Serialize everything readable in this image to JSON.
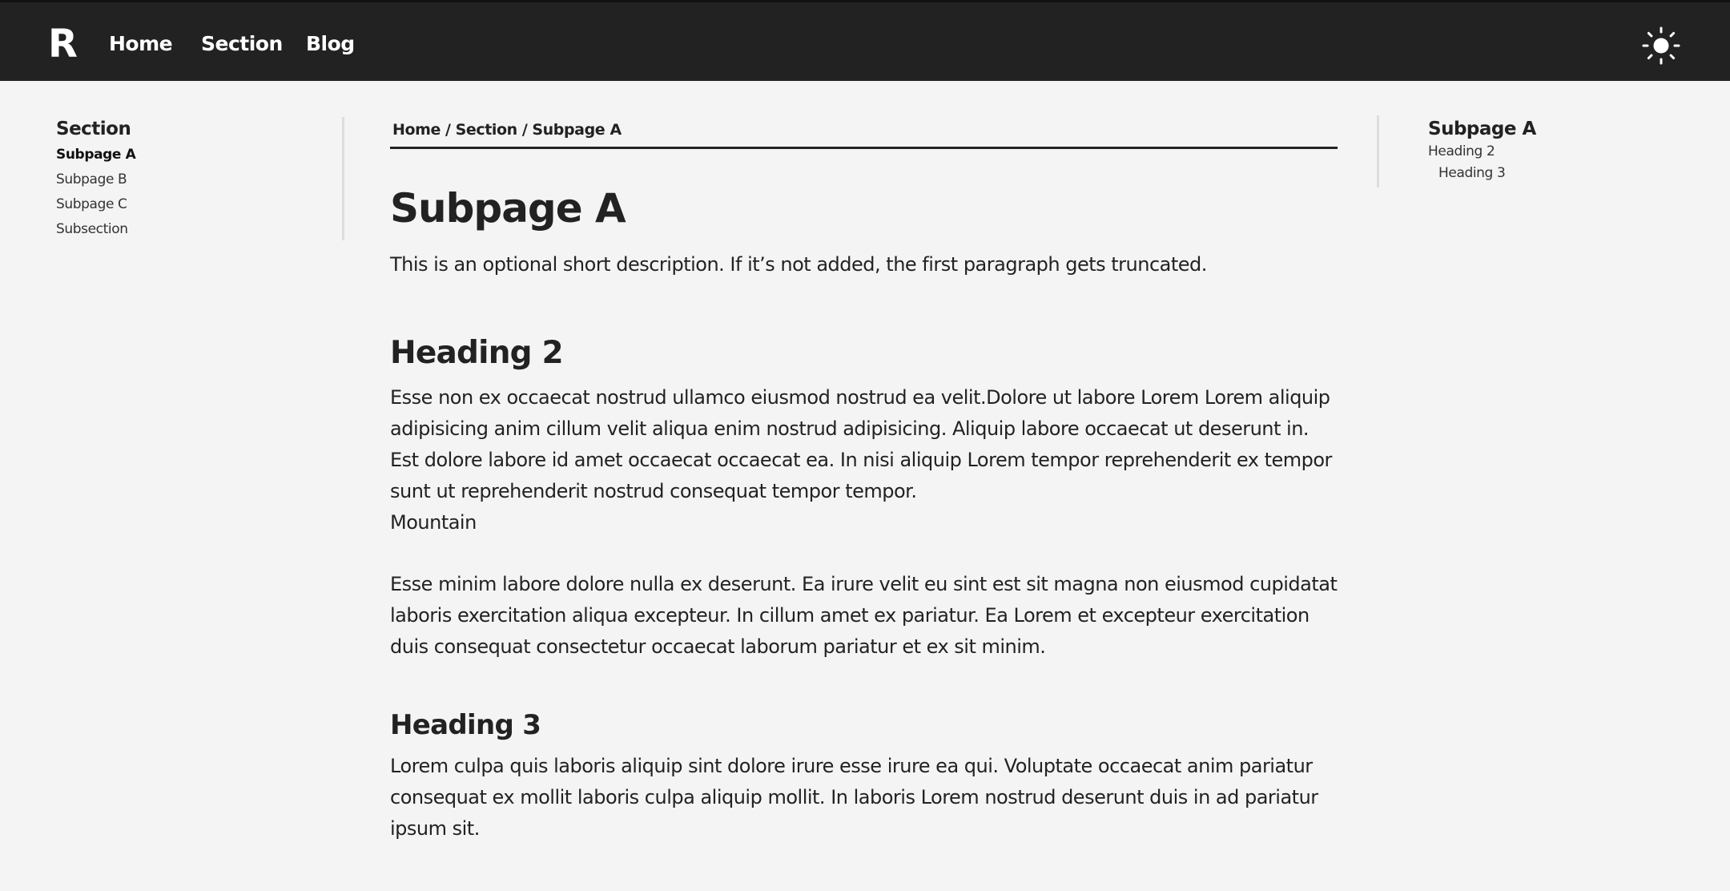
{
  "header": {
    "logo": "R",
    "nav": [
      {
        "label": "Home"
      },
      {
        "label": "Section"
      },
      {
        "label": "Blog"
      }
    ],
    "theme_icon": "sun-icon"
  },
  "sidebar": {
    "title": "Section",
    "items": [
      {
        "label": "Subpage A",
        "active": true
      },
      {
        "label": "Subpage B",
        "active": false
      },
      {
        "label": "Subpage C",
        "active": false
      },
      {
        "label": "Subsection",
        "active": false
      }
    ]
  },
  "breadcrumb": {
    "items": [
      "Home",
      "Section",
      "Subpage A"
    ],
    "separator": "/"
  },
  "main": {
    "title": "Subpage A",
    "description": "This is an optional short description. If it’s not added, the first paragraph gets truncated.",
    "heading2": "Heading 2",
    "paragraph1": "Esse non ex occaecat nostrud ullamco eiusmod nostrud ea velit.Dolore ut labore Lorem Lorem aliquip adipisicing anim cillum velit aliqua enim nostrud adipisicing. Aliquip labore occaecat ut deserunt in. Est dolore labore id amet occaecat occaecat ea. In nisi aliquip Lorem tempor reprehenderit ex tempor sunt ut reprehenderit nostrud consequat tempor tempor.",
    "image_alt": "Mountain",
    "paragraph2": "Esse minim labore dolore nulla ex deserunt. Ea irure velit eu sint est sit magna non eiusmod cupidatat laboris exercitation aliqua excepteur. In cillum amet ex pariatur. Ea Lorem et excepteur exercitation duis consequat consectetur occaecat laborum pariatur et ex sit minim.",
    "heading3": "Heading 3",
    "paragraph3": "Lorem culpa quis laboris aliquip sint dolore irure esse irure ea qui. Voluptate occaecat anim pariatur consequat ex mollit laboris culpa aliquip mollit. In laboris Lorem nostrud deserunt duis in ad pariatur ipsum sit."
  },
  "toc": {
    "title": "Subpage A",
    "items": [
      {
        "label": "Heading 2",
        "level": 2
      },
      {
        "label": "Heading 3",
        "level": 3
      }
    ]
  },
  "colors": {
    "header_bg": "#222222",
    "page_bg": "#f4f4f4",
    "text": "#222222",
    "divider": "#dddddd"
  }
}
